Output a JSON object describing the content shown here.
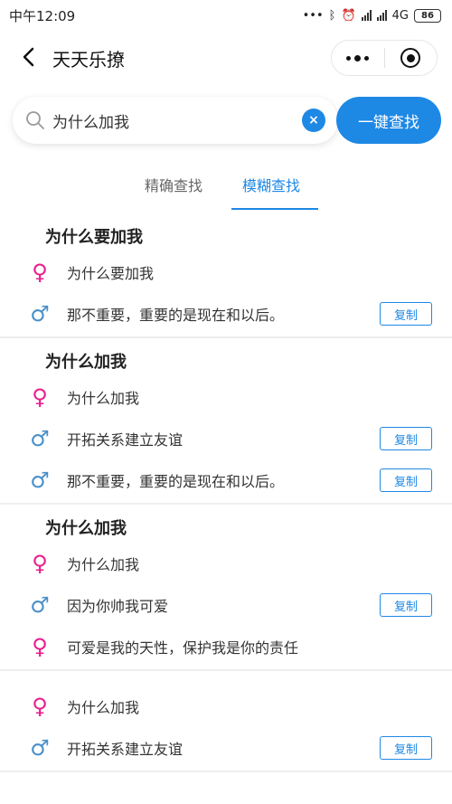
{
  "status_bar": {
    "time": "中午12:09",
    "network": "4G",
    "battery": "86"
  },
  "nav": {
    "title": "天天乐撩"
  },
  "search": {
    "query": "为什么加我",
    "button_label": "一键查找"
  },
  "tabs": [
    {
      "label": "精确查找",
      "active": false
    },
    {
      "label": "模糊查找",
      "active": true
    }
  ],
  "copy_label": "复制",
  "colors": {
    "accent": "#1e88e5",
    "female": "#e91e8c",
    "male": "#4a90c9"
  },
  "results": [
    {
      "title": "为什么要加我",
      "lines": [
        {
          "gender": "female",
          "text": "为什么要加我",
          "copy": false
        },
        {
          "gender": "male",
          "text": "那不重要，重要的是现在和以后。",
          "copy": true
        }
      ]
    },
    {
      "title": "为什么加我",
      "lines": [
        {
          "gender": "female",
          "text": "为什么加我",
          "copy": false
        },
        {
          "gender": "male",
          "text": "开拓关系建立友谊",
          "copy": true
        },
        {
          "gender": "male",
          "text": "那不重要，重要的是现在和以后。",
          "copy": true
        }
      ]
    },
    {
      "title": "为什么加我",
      "lines": [
        {
          "gender": "female",
          "text": "为什么加我",
          "copy": false
        },
        {
          "gender": "male",
          "text": "因为你帅我可爱",
          "copy": true
        },
        {
          "gender": "female",
          "text": "可爱是我的天性，保护我是你的责任",
          "copy": false
        }
      ]
    },
    {
      "title": "",
      "lines": [
        {
          "gender": "female",
          "text": "为什么加我",
          "copy": false
        },
        {
          "gender": "male",
          "text": "开拓关系建立友谊",
          "copy": true
        }
      ]
    }
  ]
}
